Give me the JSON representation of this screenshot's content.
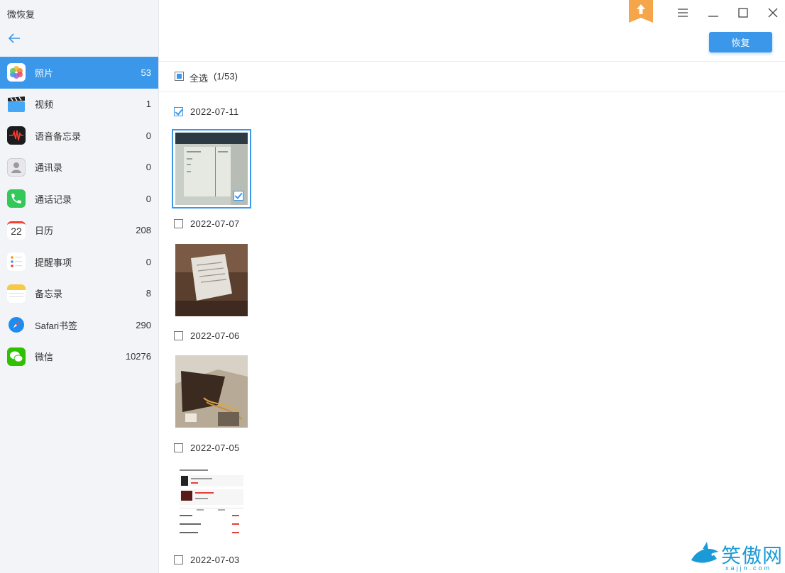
{
  "app": {
    "title": "微恢复"
  },
  "sidebar": {
    "items": [
      {
        "label": "照片",
        "count": "53",
        "icon": "photos-icon",
        "active": true
      },
      {
        "label": "视频",
        "count": "1",
        "icon": "video-icon"
      },
      {
        "label": "语音备忘录",
        "count": "0",
        "icon": "voice-memo-icon"
      },
      {
        "label": "通讯录",
        "count": "0",
        "icon": "contacts-icon"
      },
      {
        "label": "通话记录",
        "count": "0",
        "icon": "phone-icon"
      },
      {
        "label": "日历",
        "count": "208",
        "icon": "calendar-icon",
        "icon_text": "22"
      },
      {
        "label": "提醒事项",
        "count": "0",
        "icon": "reminders-icon"
      },
      {
        "label": "备忘录",
        "count": "8",
        "icon": "notes-icon"
      },
      {
        "label": "Safari书签",
        "count": "290",
        "icon": "safari-icon"
      },
      {
        "label": "微信",
        "count": "10276",
        "icon": "wechat-icon"
      }
    ]
  },
  "toolbar": {
    "recover_label": "恢复"
  },
  "selection": {
    "select_all_label": "全选",
    "select_all_count": "(1/53)"
  },
  "groups": [
    {
      "date": "2022-07-11",
      "checked": true
    },
    {
      "date": "2022-07-07",
      "checked": false
    },
    {
      "date": "2022-07-06",
      "checked": false
    },
    {
      "date": "2022-07-05",
      "checked": false
    },
    {
      "date": "2022-07-03",
      "checked": false
    }
  ],
  "watermark": {
    "text": "笑傲网",
    "sub": "xajjn.com"
  },
  "colors": {
    "accent": "#3a97ea",
    "sidebar_bg": "#f2f4f7",
    "badge": "#f5a54a"
  }
}
